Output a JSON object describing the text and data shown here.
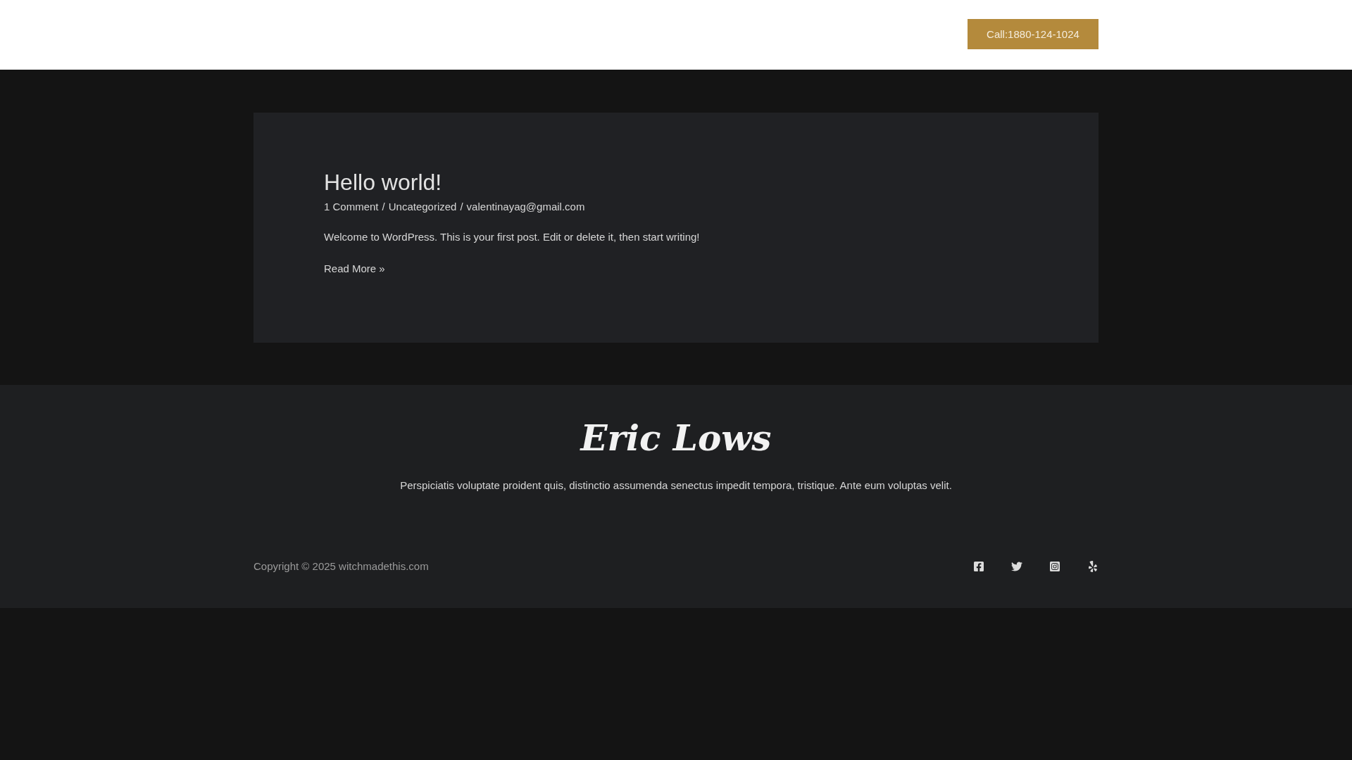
{
  "header": {
    "call_button": "Call:1880-124-1024"
  },
  "post": {
    "title": "Hello world!",
    "meta": {
      "separator": "/",
      "items": [
        "1 Comment",
        "Uncategorized",
        "valentinayag@gmail.com"
      ]
    },
    "excerpt": "Welcome to WordPress. This is your first post. Edit or delete it, then start writing!",
    "read_more": "Read More »"
  },
  "footer": {
    "logo": "Eric Lows",
    "tagline": "Perspiciatis voluptate proident quis, distinctio assumenda senectus impedit tempora, tristique. Ante eum voluptas velit.",
    "copyright": "Copyright © 2025 witchmadethis.com",
    "social": [
      {
        "kind": "facebook"
      },
      {
        "kind": "twitter"
      },
      {
        "kind": "instagram"
      },
      {
        "kind": "yelp"
      }
    ]
  }
}
